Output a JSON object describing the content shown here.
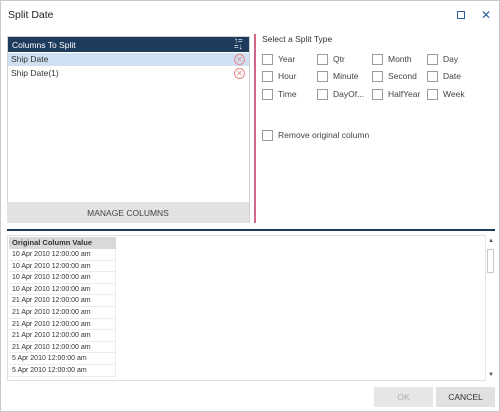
{
  "window": {
    "title": "Split Date"
  },
  "columns_panel": {
    "header": "Columns To Split",
    "items": [
      {
        "label": "Ship Date",
        "selected": true
      },
      {
        "label": "Ship Date(1)",
        "selected": false
      }
    ],
    "manage_label": "MANAGE COLUMNS"
  },
  "split_type": {
    "title": "Select a Split Type",
    "options": [
      [
        "Year",
        "Qtr",
        "Month",
        "Day"
      ],
      [
        "Hour",
        "Minute",
        "Second",
        "Date"
      ],
      [
        "Time",
        "DayOf...",
        "HalfYear",
        "Week"
      ]
    ],
    "remove_original": "Remove original column"
  },
  "preview": {
    "header": "Original Column Value",
    "rows": [
      "10 Apr 2010 12:00:00 am",
      "10 Apr 2010 12:00:00 am",
      "10 Apr 2010 12:00:00 am",
      "10 Apr 2010 12:00:00 am",
      "21 Apr 2010 12:00:00 am",
      "21 Apr 2010 12:00:00 am",
      "21 Apr 2010 12:00:00 am",
      "21 Apr 2010 12:00:00 am",
      "21 Apr 2010 12:00:00 am",
      "5 Apr 2010 12:00:00 am",
      "5 Apr 2010 12:00:00 am"
    ]
  },
  "footer": {
    "ok_label": "OK",
    "cancel_label": "CANCEL"
  },
  "colors": {
    "header_bg": "#1e3a5c",
    "selected_row": "#cfe0f2",
    "divider_accent": "#d4658a",
    "remove_icon": "#e58b8b"
  }
}
